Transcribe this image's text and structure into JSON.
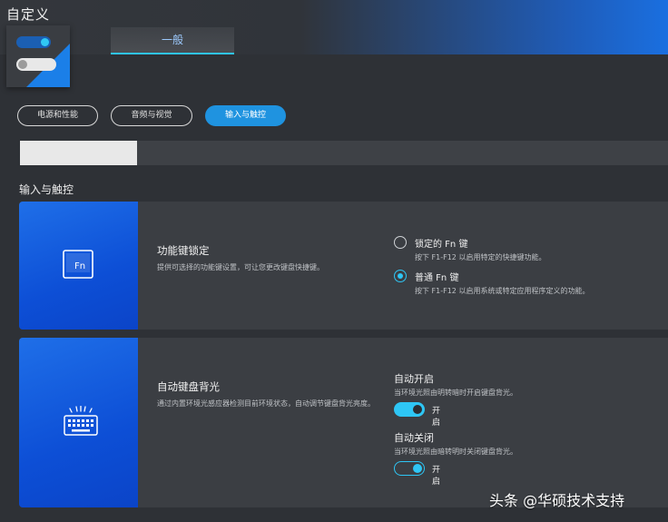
{
  "window": {
    "title": "自定义"
  },
  "header": {
    "tab_label": "一般"
  },
  "categories": [
    {
      "label": "电源和性能",
      "active": false
    },
    {
      "label": "音频与视觉",
      "active": false
    },
    {
      "label": "输入与触控",
      "active": true
    }
  ],
  "section": {
    "title": "输入与触控"
  },
  "fn_lock": {
    "title": "功能键锁定",
    "description": "提供可选择的功能键设置，可让您更改键盘快捷键。",
    "icon": "fn-key-icon",
    "options": [
      {
        "label": "锁定的 Fn 键",
        "description": "按下 F1-F12 以启用特定的快捷键功能。",
        "selected": false
      },
      {
        "label": "普通 Fn 键",
        "description": "按下 F1-F12 以启用系统或特定应用程序定义的功能。",
        "selected": true
      }
    ]
  },
  "kb_backlight": {
    "title": "自动键盘背光",
    "description": "通过内置环境光感应器检测目前环境状态，自动调节键盘背光亮度。",
    "icon": "backlit-keyboard-icon",
    "auto_on": {
      "title": "自动开启",
      "description": "当环境光照由明转暗时开启键盘背光。",
      "state_label": "开启",
      "enabled": true
    },
    "auto_off": {
      "title": "自动关闭",
      "description": "当环境光照由暗转明时关闭键盘背光。",
      "state_label": "开启",
      "enabled": true
    }
  },
  "watermark": {
    "text": "头条 @华硕技术支持"
  },
  "colors": {
    "accent": "#2ec6f5",
    "active_pill": "#1f93e0",
    "card_icon_blue": "#0d4fd6",
    "background": "#2e3136"
  }
}
